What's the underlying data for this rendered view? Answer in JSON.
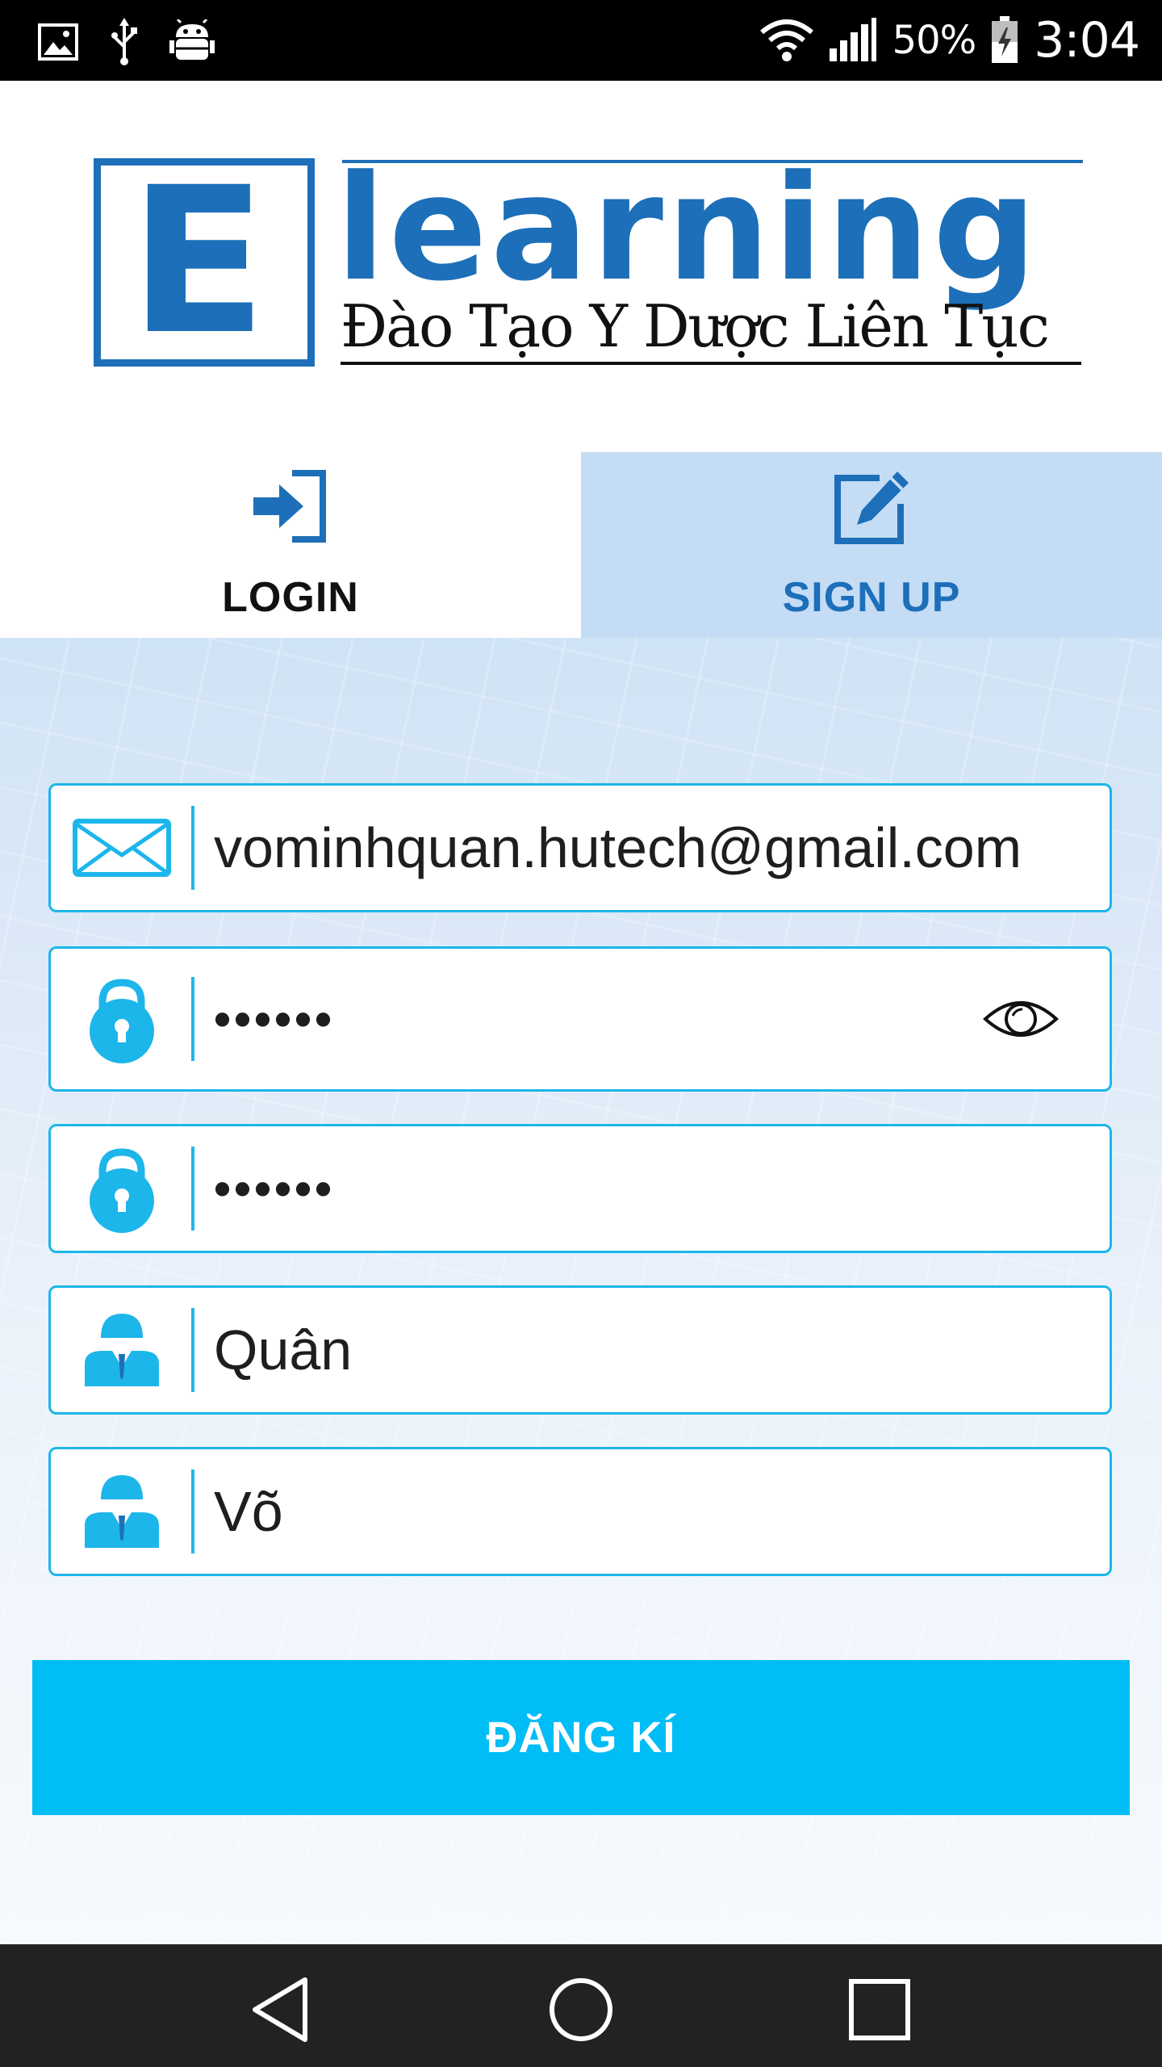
{
  "status_bar": {
    "left_icons": [
      "image-icon",
      "usb-icon",
      "android-debug-icon"
    ],
    "wifi_icon": "wifi-icon",
    "signal_icon": "signal-icon",
    "battery_percent": "50%",
    "battery_icon": "battery-charging-icon",
    "time": "3:04"
  },
  "logo": {
    "letter": "E",
    "word": "learning",
    "tagline": "Đào Tạo Y Dược Liên Tục"
  },
  "tabs": [
    {
      "label": "LOGIN",
      "icon": "login-icon",
      "active": false
    },
    {
      "label": "SIGN UP",
      "icon": "edit-icon",
      "active": true
    }
  ],
  "form": {
    "email": {
      "icon": "mail-icon",
      "value": "vominhquan.hutech@gmail.com"
    },
    "password": {
      "icon": "lock-icon",
      "value": "••••••",
      "toggle_icon": "eye-icon"
    },
    "confirm_password": {
      "icon": "lock-icon",
      "value": "••••••"
    },
    "first_name": {
      "icon": "user-icon",
      "value": "Quân"
    },
    "last_name": {
      "icon": "user-icon",
      "value": "Võ"
    },
    "submit_label": "ĐĂNG KÍ"
  },
  "colors": {
    "brand_blue": "#1c6fb8",
    "accent_cyan": "#00bdf6",
    "field_border": "#1cb6ea",
    "tab_active_bg": "#c5dcf5"
  },
  "nav_bar": {
    "buttons": [
      "back-icon",
      "home-icon",
      "recent-apps-icon"
    ]
  }
}
